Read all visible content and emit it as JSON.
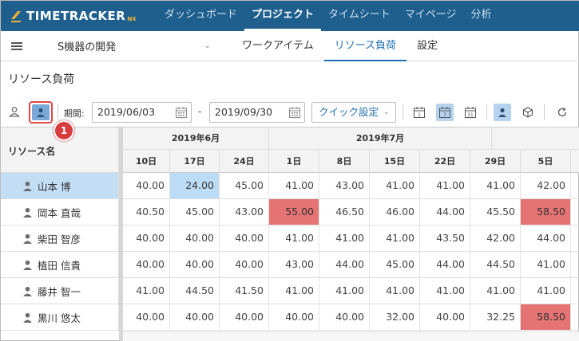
{
  "app": {
    "logo_text": "TIMETRACKER",
    "logo_sub": "NX",
    "nav": [
      {
        "label": "ダッシュボード"
      },
      {
        "label": "プロジェクト"
      },
      {
        "label": "タイムシート"
      },
      {
        "label": "マイページ"
      },
      {
        "label": "分析"
      }
    ]
  },
  "project": {
    "name": "S機器の開発",
    "tabs": [
      {
        "label": "ワークアイテム"
      },
      {
        "label": "リソース負荷"
      },
      {
        "label": "設定"
      }
    ]
  },
  "page": {
    "title": "リソース負荷"
  },
  "toolbar": {
    "callout_number": "1",
    "period_label": "期間:",
    "start_date": "2019/06/03",
    "separator": "-",
    "end_date": "2019/09/30",
    "quick_setting": "クイック設定",
    "view_day": "1",
    "view_week": "7",
    "view_month": "31"
  },
  "grid": {
    "row_header_title": "リソース名",
    "months": [
      "2019年6月",
      "2019年7月"
    ],
    "days": [
      "10日",
      "17日",
      "24日",
      "1日",
      "8日",
      "15日",
      "22日",
      "29日",
      "5日"
    ],
    "rows": [
      {
        "name": "山本 博",
        "values": [
          "40.00",
          "24.00",
          "45.00",
          "41.00",
          "43.00",
          "41.00",
          "41.00",
          "41.00",
          "42.00"
        ]
      },
      {
        "name": "岡本 直哉",
        "values": [
          "40.50",
          "45.00",
          "43.00",
          "55.00",
          "46.50",
          "46.00",
          "44.00",
          "45.50",
          "58.50"
        ]
      },
      {
        "name": "柴田 智彦",
        "values": [
          "40.00",
          "40.00",
          "40.00",
          "41.00",
          "41.00",
          "41.00",
          "43.50",
          "42.00",
          "44.00"
        ]
      },
      {
        "name": "植田 信貴",
        "values": [
          "40.00",
          "40.00",
          "40.00",
          "43.00",
          "44.00",
          "45.00",
          "44.00",
          "44.50",
          "41.00"
        ]
      },
      {
        "name": "藤井 智一",
        "values": [
          "41.00",
          "44.50",
          "41.50",
          "41.00",
          "41.00",
          "41.00",
          "41.00",
          "41.00",
          "41.00"
        ]
      },
      {
        "name": "黒川 悠太",
        "values": [
          "40.00",
          "40.00",
          "40.00",
          "40.00",
          "40.00",
          "32.00",
          "40.00",
          "32.25",
          "58.50"
        ]
      }
    ],
    "highlight_colors": {
      "under": "#bcdcf6",
      "over": "#e57373",
      "selected_row": "#c3ddf4"
    }
  },
  "colors": {
    "nav_bg": "#1e5f8e",
    "accent": "#1e6fb4",
    "callout": "#d93c3c"
  }
}
